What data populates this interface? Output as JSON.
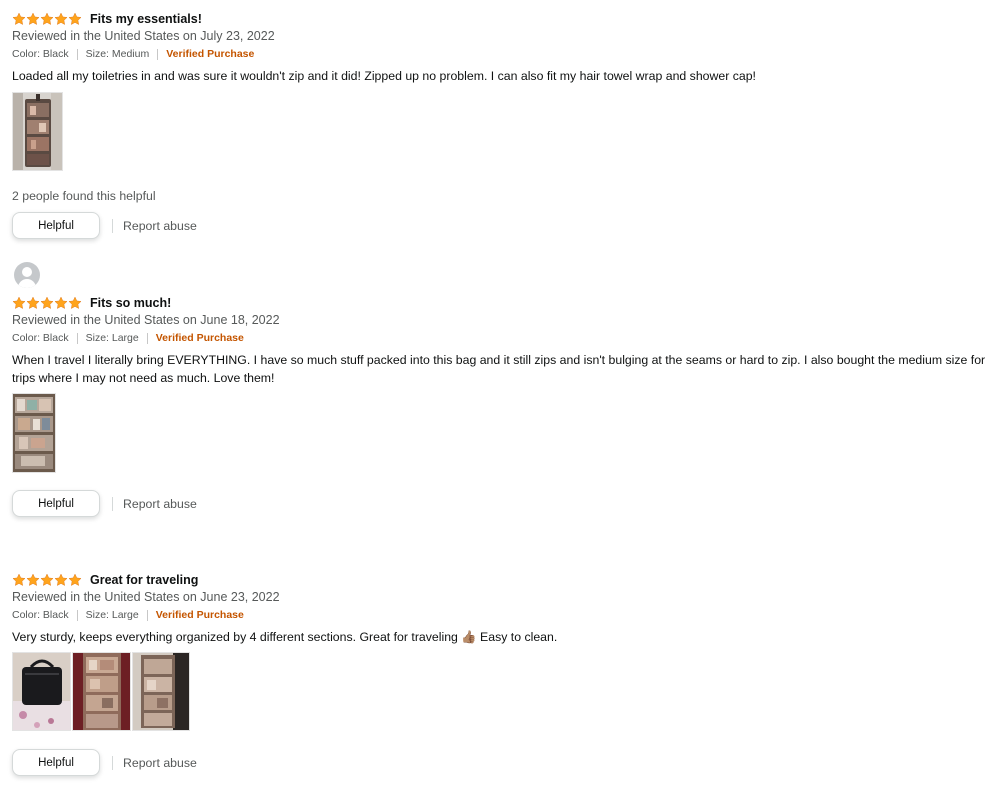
{
  "colors": {
    "star": "#ffa41c",
    "verified": "#c45500",
    "meta_text": "#565959",
    "body_text": "#0f1111"
  },
  "reviews": [
    {
      "rating": 5,
      "title": "Fits my essentials!",
      "reviewed": "Reviewed in the United States on July 23, 2022",
      "color": "Color: Black",
      "size": "Size: Medium",
      "verified": "Verified Purchase",
      "body": "Loaded all my toiletries in and was sure it wouldn't zip and it did! Zipped up no problem. I can also fit my hair towel wrap and shower cap!",
      "helpful_count": "2 people found this helpful",
      "helpful_label": "Helpful",
      "report_label": "Report abuse"
    },
    {
      "rating": 5,
      "title": "Fits so much!",
      "reviewed": "Reviewed in the United States on June 18, 2022",
      "color": "Color: Black",
      "size": "Size: Large",
      "verified": "Verified Purchase",
      "body": "When I travel I literally bring EVERYTHING. I have so much stuff packed into this bag and it still zips and isn't bulging at the seams or hard to zip. I also bought the medium size for trips where I may not need as much. Love them!",
      "helpful_label": "Helpful",
      "report_label": "Report abuse"
    },
    {
      "rating": 5,
      "title": "Great for traveling",
      "reviewed": "Reviewed in the United States on June 23, 2022",
      "color": "Color: Black",
      "size": "Size: Large",
      "verified": "Verified Purchase",
      "body": "Very sturdy, keeps everything organized by 4 different sections. Great for traveling 👍🏽 Easy to clean.",
      "helpful_label": "Helpful",
      "report_label": "Report abuse"
    }
  ]
}
